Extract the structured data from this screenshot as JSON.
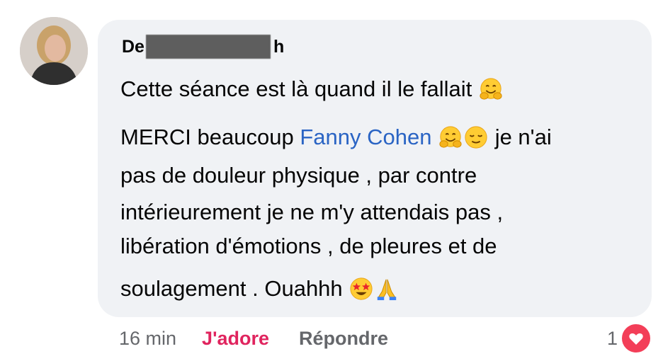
{
  "comment": {
    "author_start": "De",
    "author_end": "h",
    "lines": [
      "Cette séance est là quand il le fallait",
      "MERCI beaucoup",
      "Fanny Cohen",
      "je n'ai",
      "pas de douleur physique , par contre",
      "intérieurement je ne m'y attendais pas ,",
      "libération d'émotions ,  de pleures et de",
      "soulagement . Ouahhh"
    ],
    "emoji": {
      "hug": "hugging-face-icon",
      "relieved": "relieved-face-icon",
      "starstruck": "star-struck-icon",
      "pray": "folded-hands-icon"
    }
  },
  "actions": {
    "time": "16 min",
    "reaction_label": "J'adore",
    "reply_label": "Répondre",
    "reaction_count": "1"
  },
  "colors": {
    "bubble": "#f0f2f5",
    "mention": "#2a64c4",
    "love": "#e0245e",
    "heart_badge": "#f33e58",
    "muted": "#65676b"
  }
}
